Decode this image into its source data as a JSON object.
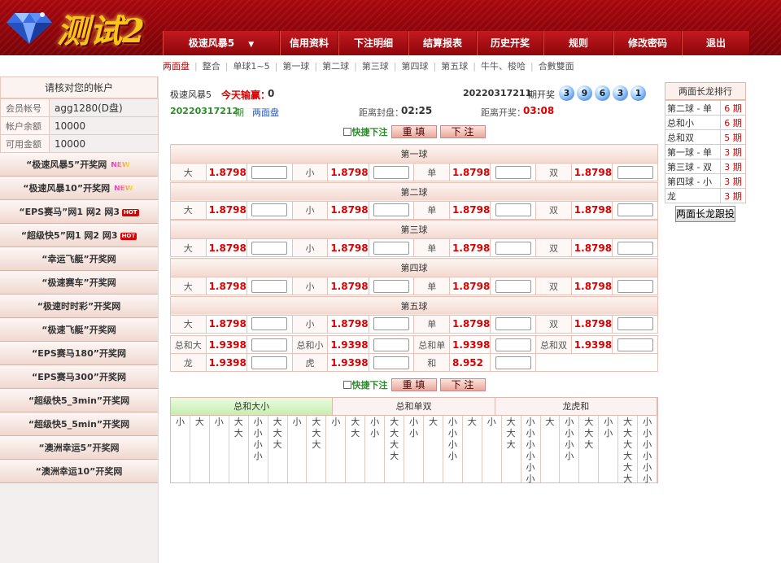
{
  "logo": {
    "text": "测试2"
  },
  "nav": [
    "极速风暴5",
    "信用资料",
    "下注明细",
    "结算报表",
    "历史开奖",
    "规则",
    "修改密码",
    "退出"
  ],
  "subnav": [
    "两面盘",
    "整合",
    "单球1~5",
    "第一球",
    "第二球",
    "第三球",
    "第四球",
    "第五球",
    "牛牛、梭哈",
    "合數雙面"
  ],
  "side": {
    "title": "请核对您的帐户",
    "account": [
      {
        "label": "会员帐号",
        "value": "agg1280(D盘)"
      },
      {
        "label": "帐户余额",
        "value": "10000"
      },
      {
        "label": "可用金额",
        "value": "10000"
      }
    ],
    "links": [
      {
        "text": "“极速风暴5”开奖网",
        "badge": "NEW"
      },
      {
        "text": "“极速风暴10”开奖网",
        "badge": "NEW"
      },
      {
        "text": "“EPS赛马”网1 网2 网3",
        "badge": "HOT"
      },
      {
        "text": "“超级快5”网1 网2 网3",
        "badge": "HOT"
      },
      {
        "text": "“幸运飞艇”开奖网",
        "badge": ""
      },
      {
        "text": "“极速赛车”开奖网",
        "badge": ""
      },
      {
        "text": "“极速时时彩”开奖网",
        "badge": ""
      },
      {
        "text": "“极速飞艇”开奖网",
        "badge": ""
      },
      {
        "text": "“EPS赛马180”开奖网",
        "badge": ""
      },
      {
        "text": "“EPS赛马300”开奖网",
        "badge": ""
      },
      {
        "text": "“超级快5_3min”开奖网",
        "badge": ""
      },
      {
        "text": "“超级快5_5min”开奖网",
        "badge": ""
      },
      {
        "text": "“澳洲幸运5”开奖网",
        "badge": ""
      },
      {
        "text": "“澳洲幸运10”开奖网",
        "badge": ""
      }
    ]
  },
  "info": {
    "game": "极速风暴5",
    "today_label": "今天输赢：",
    "today_value": "0",
    "last_period": "20220317211",
    "last_suffix": "期开奖",
    "balls": [
      "3",
      "9",
      "6",
      "3",
      "1"
    ],
    "period": "20220317212",
    "period_suffix": "期",
    "mode": "两面盘",
    "close_label": "距离封盘：",
    "close_time": "02:25",
    "open_label": "距离开奖：",
    "open_time": "03:08"
  },
  "controls": {
    "quick": "快捷下注",
    "reset": "重 填",
    "submit": "下 注"
  },
  "groups": [
    {
      "title": "第一球",
      "items": [
        {
          "label": "大",
          "odds": "1.8798"
        },
        {
          "label": "小",
          "odds": "1.8798"
        },
        {
          "label": "单",
          "odds": "1.8798"
        },
        {
          "label": "双",
          "odds": "1.8798"
        }
      ]
    },
    {
      "title": "第二球",
      "items": [
        {
          "label": "大",
          "odds": "1.8798"
        },
        {
          "label": "小",
          "odds": "1.8798"
        },
        {
          "label": "单",
          "odds": "1.8798"
        },
        {
          "label": "双",
          "odds": "1.8798"
        }
      ]
    },
    {
      "title": "第三球",
      "items": [
        {
          "label": "大",
          "odds": "1.8798"
        },
        {
          "label": "小",
          "odds": "1.8798"
        },
        {
          "label": "单",
          "odds": "1.8798"
        },
        {
          "label": "双",
          "odds": "1.8798"
        }
      ]
    },
    {
      "title": "第四球",
      "items": [
        {
          "label": "大",
          "odds": "1.8798"
        },
        {
          "label": "小",
          "odds": "1.8798"
        },
        {
          "label": "单",
          "odds": "1.8798"
        },
        {
          "label": "双",
          "odds": "1.8798"
        }
      ]
    },
    {
      "title": "第五球",
      "items": [
        {
          "label": "大",
          "odds": "1.8798"
        },
        {
          "label": "小",
          "odds": "1.8798"
        },
        {
          "label": "单",
          "odds": "1.8798"
        },
        {
          "label": "双",
          "odds": "1.8798"
        }
      ]
    }
  ],
  "totals": [
    [
      {
        "label": "总和大",
        "odds": "1.9398"
      },
      {
        "label": "总和小",
        "odds": "1.9398"
      },
      {
        "label": "总和单",
        "odds": "1.9398"
      },
      {
        "label": "总和双",
        "odds": "1.9398"
      }
    ],
    [
      {
        "label": "龙",
        "odds": "1.9398"
      },
      {
        "label": "虎",
        "odds": "1.9398"
      },
      {
        "label": "和",
        "odds": "8.952"
      }
    ]
  ],
  "road": {
    "tabs": [
      "总和大小",
      "总和单双",
      "龙虎和"
    ],
    "columns": [
      [
        "小"
      ],
      [
        "大"
      ],
      [
        "小"
      ],
      [
        "大",
        "大"
      ],
      [
        "小",
        "小",
        "小",
        "小"
      ],
      [
        "大",
        "大",
        "大"
      ],
      [
        "小"
      ],
      [
        "大",
        "大",
        "大"
      ],
      [
        "小"
      ],
      [
        "大",
        "大"
      ],
      [
        "小",
        "小"
      ],
      [
        "大",
        "大",
        "大",
        "大"
      ],
      [
        "小",
        "小"
      ],
      [
        "大"
      ],
      [
        "小",
        "小",
        "小",
        "小"
      ],
      [
        "大"
      ],
      [
        "小"
      ],
      [
        "大",
        "大",
        "大"
      ],
      [
        "小",
        "小",
        "小",
        "小",
        "小",
        "小"
      ],
      [
        "大"
      ],
      [
        "小",
        "小",
        "小",
        "小"
      ],
      [
        "大",
        "大",
        "大"
      ],
      [
        "小",
        "小"
      ],
      [
        "大",
        "大",
        "大",
        "大",
        "大",
        "大"
      ],
      [
        "小",
        "小",
        "小",
        "小",
        "小",
        "小"
      ]
    ]
  },
  "rank": {
    "title": "两面长龙排行",
    "rows": [
      {
        "name": "第二球 - 单",
        "count": "6 期"
      },
      {
        "name": "总和小",
        "count": "6 期"
      },
      {
        "name": "总和双",
        "count": "5 期"
      },
      {
        "name": "第一球 - 单",
        "count": "3 期"
      },
      {
        "name": "第三球 - 双",
        "count": "3 期"
      },
      {
        "name": "第四球 - 小",
        "count": "3 期"
      },
      {
        "name": "龙",
        "count": "3 期"
      }
    ],
    "follow": "两面长龙跟投"
  }
}
